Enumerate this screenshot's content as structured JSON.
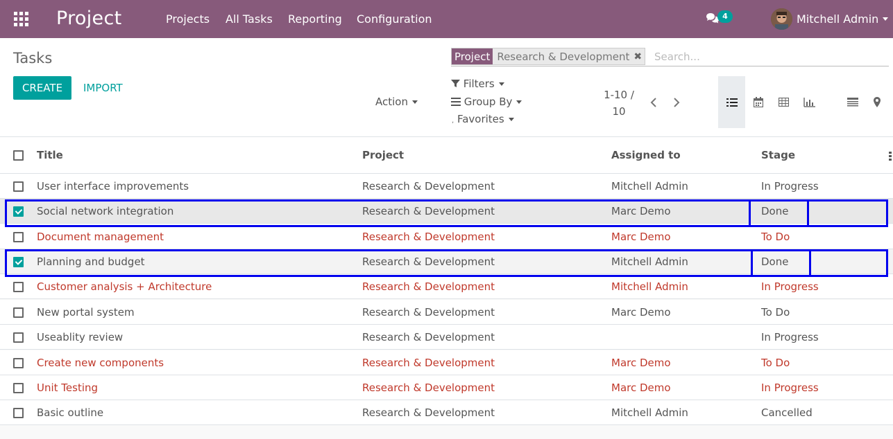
{
  "app": {
    "brand": "Project",
    "menu": [
      "Projects",
      "All Tasks",
      "Reporting",
      "Configuration"
    ],
    "chat_count": "4",
    "user_name": "Mitchell Admin",
    "accent_color": "#875a7b",
    "primary_color": "#00a09d"
  },
  "control_panel": {
    "breadcrumb": "Tasks",
    "create_label": "CREATE",
    "import_label": "IMPORT",
    "action_label": "Action",
    "filters_label": "Filters",
    "groupby_label": "Group By",
    "favorites_label": "Favorites",
    "search": {
      "facet_label": "Project",
      "facet_value": "Research & Development",
      "placeholder": "Search..."
    },
    "pager": {
      "range": "1-10 /",
      "total": "10"
    },
    "views": [
      "list-view-icon",
      "calendar-view-icon",
      "pivot-view-icon",
      "graph-view-icon",
      "activity-view-icon",
      "map-view-icon"
    ],
    "active_view": "list"
  },
  "table": {
    "headers": {
      "title": "Title",
      "project": "Project",
      "assigned": "Assigned to",
      "stage": "Stage"
    },
    "rows": [
      {
        "title": "User interface improvements",
        "project": "Research & Development",
        "assigned": "Mitchell Admin",
        "stage": "In Progress"
      },
      {
        "title": "Social network integration",
        "project": "Research & Development",
        "assigned": "Marc Demo",
        "stage": "Done"
      },
      {
        "title": "Document management",
        "project": "Research & Development",
        "assigned": "Marc Demo",
        "stage": "To Do"
      },
      {
        "title": "Planning and budget",
        "project": "Research & Development",
        "assigned": "Mitchell Admin",
        "stage": "Done"
      },
      {
        "title": "Customer analysis + Architecture",
        "project": "Research & Development",
        "assigned": "Mitchell Admin",
        "stage": "In Progress"
      },
      {
        "title": "New portal system",
        "project": "Research & Development",
        "assigned": "Marc Demo",
        "stage": "To Do"
      },
      {
        "title": "Useablity review",
        "project": "Research & Development",
        "assigned": "",
        "stage": "In Progress"
      },
      {
        "title": "Create new components",
        "project": "Research & Development",
        "assigned": "Marc Demo",
        "stage": "To Do"
      },
      {
        "title": "Unit Testing",
        "project": "Research & Development",
        "assigned": "Marc Demo",
        "stage": "In Progress"
      },
      {
        "title": "Basic outline",
        "project": "Research & Development",
        "assigned": "Mitchell Admin",
        "stage": "Cancelled"
      }
    ]
  }
}
